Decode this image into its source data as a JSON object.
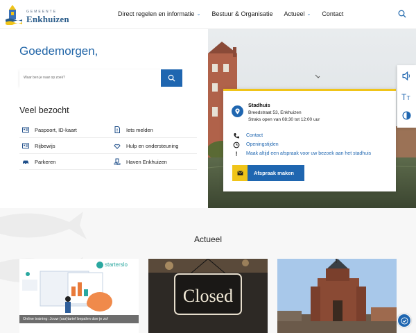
{
  "header": {
    "logo_small": "GEMEENTE",
    "logo_name": "Enkhuizen",
    "nav": [
      {
        "label": "Direct regelen en informatie",
        "has_dropdown": true
      },
      {
        "label": "Bestuur & Organisatie",
        "has_dropdown": false
      },
      {
        "label": "Actueel",
        "has_dropdown": true
      },
      {
        "label": "Contact",
        "has_dropdown": false
      }
    ]
  },
  "hero": {
    "greeting": "Goedemorgen,",
    "search": {
      "placeholder": "Waar ben je naar op zoek?"
    },
    "popular_title": "Veel bezocht",
    "popular_links": [
      {
        "label": "Paspoort, ID-kaart",
        "icon": "id-card-icon"
      },
      {
        "label": "Iets melden",
        "icon": "report-file-icon"
      },
      {
        "label": "Rijbewijs",
        "icon": "license-card-icon"
      },
      {
        "label": "Hulp en ondersteuning",
        "icon": "helping-hands-icon"
      },
      {
        "label": "Parkeren",
        "icon": "car-icon"
      },
      {
        "label": "Haven Enkhuizen",
        "icon": "harbor-icon"
      }
    ]
  },
  "info_card": {
    "title": "Stadhuis",
    "address": "Breedstraat 53, Enkhuizen",
    "hours": "Straks open van 08:30 tot 12:00 uur",
    "links": [
      {
        "label": "Contact",
        "icon": "phone-icon"
      },
      {
        "label": "Openingstijden",
        "icon": "clock-hand-icon"
      },
      {
        "label": "Maak altijd een afspraak voor uw bezoek aan het stadhuis",
        "icon": "exclamation-icon"
      }
    ],
    "appointment_button": "Afspraak maken"
  },
  "accessibility_tools": [
    "speaker-icon",
    "text-size-icon",
    "contrast-icon"
  ],
  "news": {
    "title": "Actueel",
    "items": [
      {
        "caption": "Online training: Jouw (uur)tarief bepalen doe je zo!",
        "image_text": "starterslo­ket",
        "image_sub": "Tarief bepalen"
      },
      {
        "caption": "",
        "image_text": "Closed"
      },
      {
        "caption": "",
        "image_text": ""
      }
    ]
  },
  "colors": {
    "accent_blue": "#1f66b0",
    "accent_yellow": "#f0c419",
    "greeting_blue": "#2266a8"
  }
}
